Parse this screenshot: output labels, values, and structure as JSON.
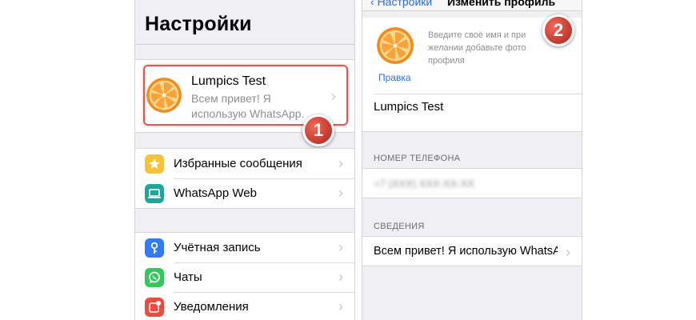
{
  "colors": {
    "highlight": "#e4574f",
    "badge": "#d8453a",
    "link": "#2d6ed6",
    "favorites_icon": "#f5c33b",
    "web_icon": "#20a59a",
    "account_icon": "#2f7cf6",
    "chats_icon": "#34c759",
    "notifications_icon": "#ef4a3e"
  },
  "left": {
    "title": "Настройки",
    "profile": {
      "name": "Lumpics Test",
      "status": "Всем привет! Я использую WhatsApp.",
      "avatar_icon": "orange-slice-icon"
    },
    "badge": "1",
    "group1": [
      {
        "label": "Избранные сообщения",
        "icon": "star-icon"
      },
      {
        "label": "WhatsApp Web",
        "icon": "laptop-icon"
      }
    ],
    "group2": [
      {
        "label": "Учётная запись",
        "icon": "key-icon"
      },
      {
        "label": "Чаты",
        "icon": "whatsapp-icon"
      },
      {
        "label": "Уведомления",
        "icon": "notification-icon"
      }
    ]
  },
  "right": {
    "nav_back": "Настройки",
    "nav_title": "Изменить профиль",
    "badge": "2",
    "hint": "Введите своё имя и при желании добавьте фото профиля",
    "edit_link": "Правка",
    "name": "Lumpics Test",
    "phone_header": "НОМЕР ТЕЛЕФОНА",
    "phone_value": "+7 (XXX) XXX-XX-XX",
    "about_header": "СВЕДЕНИЯ",
    "about_value": "Всем привет! Я использую WhatsApp."
  }
}
